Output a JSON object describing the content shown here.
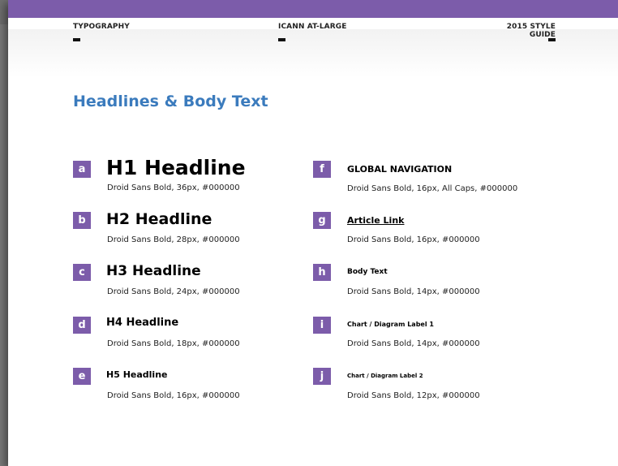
{
  "header": {
    "left": "TYPOGRAPHY",
    "center": "ICANN AT-LARGE",
    "right": "2015 STYLE GUIDE"
  },
  "section_title": "Headlines & Body Text",
  "left_items": [
    {
      "badge": "a",
      "title": "H1 Headline",
      "desc": "Droid Sans Bold, 36px, #000000"
    },
    {
      "badge": "b",
      "title": "H2 Headline",
      "desc": "Droid Sans Bold, 28px, #000000"
    },
    {
      "badge": "c",
      "title": "H3 Headline",
      "desc": "Droid Sans Bold, 24px, #000000"
    },
    {
      "badge": "d",
      "title": "H4 Headline",
      "desc": "Droid Sans Bold, 18px, #000000"
    },
    {
      "badge": "e",
      "title": "H5 Headline",
      "desc": "Droid Sans Bold, 16px, #000000"
    }
  ],
  "right_items": [
    {
      "badge": "f",
      "title": "GLOBAL NAVIGATION",
      "desc": "Droid Sans Bold, 16px, All Caps, #000000"
    },
    {
      "badge": "g",
      "title": "Article Link",
      "desc": "Droid Sans Bold, 16px, #000000"
    },
    {
      "badge": "h",
      "title": "Body Text",
      "desc": "Droid Sans Bold, 14px, #000000"
    },
    {
      "badge": "i",
      "title": "Chart / Diagram Label 1",
      "desc": "Droid Sans Bold, 14px, #000000"
    },
    {
      "badge": "j",
      "title": "Chart / Diagram Label 2",
      "desc": "Droid Sans Bold, 12px, #000000"
    }
  ],
  "colors": {
    "accent_purple": "#7c5caa",
    "title_blue": "#3b7bbd",
    "text": "#000000"
  }
}
